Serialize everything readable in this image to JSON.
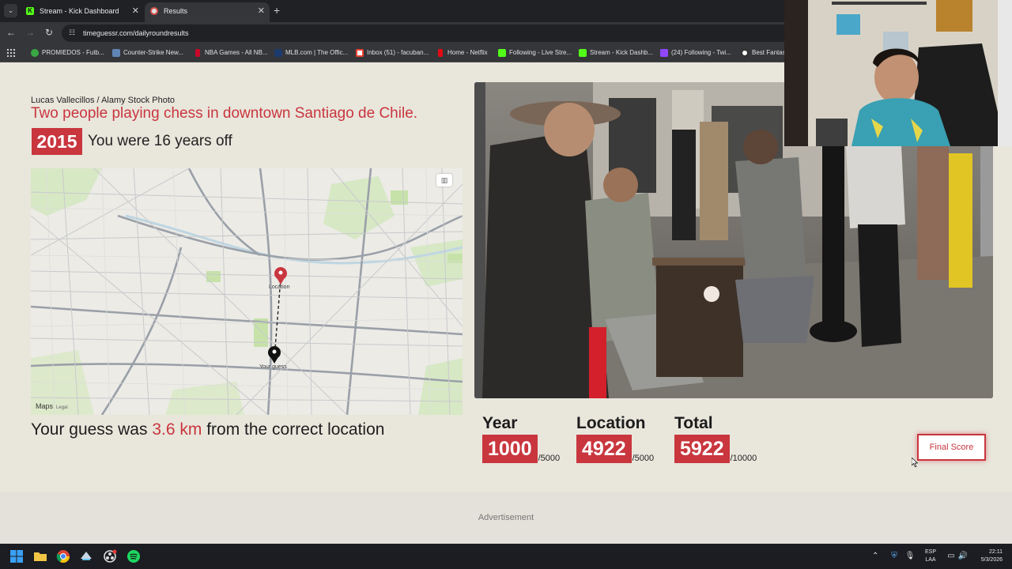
{
  "browser": {
    "tabs": [
      {
        "label": "Stream - Kick Dashboard",
        "active": false,
        "icon": "kick-icon"
      },
      {
        "label": "Results",
        "active": true,
        "icon": "timeguessr-icon"
      }
    ],
    "new_tab_label": "+",
    "url": "timeguessr.com/dailyroundresults",
    "bookmarks": [
      {
        "label": "PROMIEDOS - Futb...",
        "color": "#39a844"
      },
      {
        "label": "Counter-Strike New...",
        "color": "#5f85b4"
      },
      {
        "label": "NBA Games - All NB...",
        "color": "#c9082a"
      },
      {
        "label": "MLB.com | The Offic...",
        "color": "#1d3a6e"
      },
      {
        "label": "Inbox (51) - facuban...",
        "color": "#ea4335"
      },
      {
        "label": "Home - Netflix",
        "color": "#e50914"
      },
      {
        "label": "Following - Live Stre...",
        "color": "#53fc18"
      },
      {
        "label": "Stream - Kick Dashb...",
        "color": "#53fc18"
      },
      {
        "label": "(24) Following - Twi...",
        "color": "#9146ff"
      },
      {
        "label": "Best Fantas...",
        "color": "#d0d0d0"
      }
    ]
  },
  "result": {
    "photo_credit": "Lucas Vallecillos / Alamy Stock Photo",
    "caption": "Two people playing chess in downtown Santiago de Chile.",
    "year": "2015",
    "years_off_text": "You were 16 years off",
    "distance_prefix": "Your guess was ",
    "distance_value": "3.6 km",
    "distance_suffix": " from the correct location"
  },
  "map": {
    "location_label": "Location",
    "guess_label": "Your guess",
    "brand": "Maps",
    "brand_text": "Maps",
    "legal": "Legal"
  },
  "scores": [
    {
      "label": "Year",
      "value": "1000",
      "max": "/5000"
    },
    {
      "label": "Location",
      "value": "4922",
      "max": "/5000"
    },
    {
      "label": "Total",
      "value": "5922",
      "max": "/10000"
    }
  ],
  "final_score_button": "Final Score",
  "advertisement_label": "Advertisement",
  "taskbar": {
    "lang_top": "ESP",
    "lang_bottom": "LAA",
    "time": "22:11",
    "date": "5/3/2026"
  },
  "colors": {
    "accent": "#c9363e",
    "page_bg": "#e9e6dc"
  }
}
